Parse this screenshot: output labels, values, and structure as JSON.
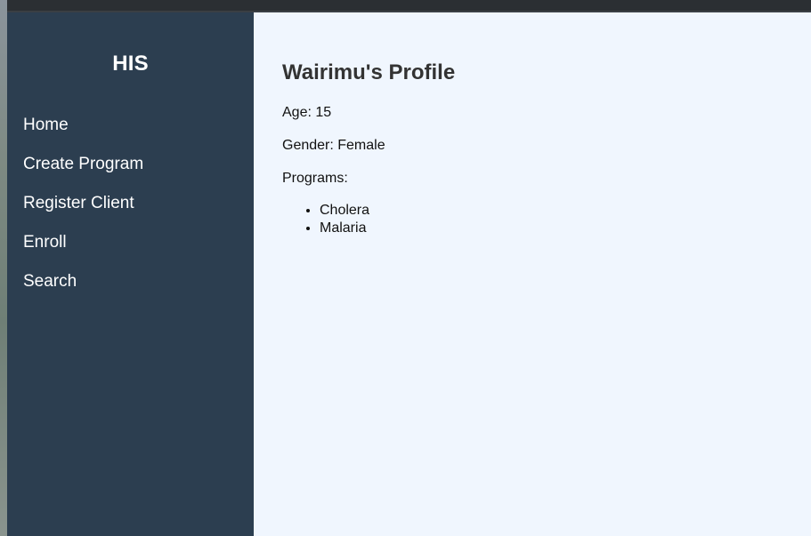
{
  "sidebar": {
    "brand": "HIS",
    "items": [
      {
        "label": "Home"
      },
      {
        "label": "Create Program"
      },
      {
        "label": "Register Client"
      },
      {
        "label": "Enroll"
      },
      {
        "label": "Search"
      }
    ]
  },
  "profile": {
    "title": "Wairimu's Profile",
    "age_line": "Age: 15",
    "gender_line": "Gender: Female",
    "programs_label": "Programs:",
    "programs": [
      "Cholera",
      "Malaria"
    ]
  },
  "colors": {
    "sidebar_bg": "#2c3e50",
    "main_bg": "#f0f6fe",
    "title_text": "#333333"
  }
}
